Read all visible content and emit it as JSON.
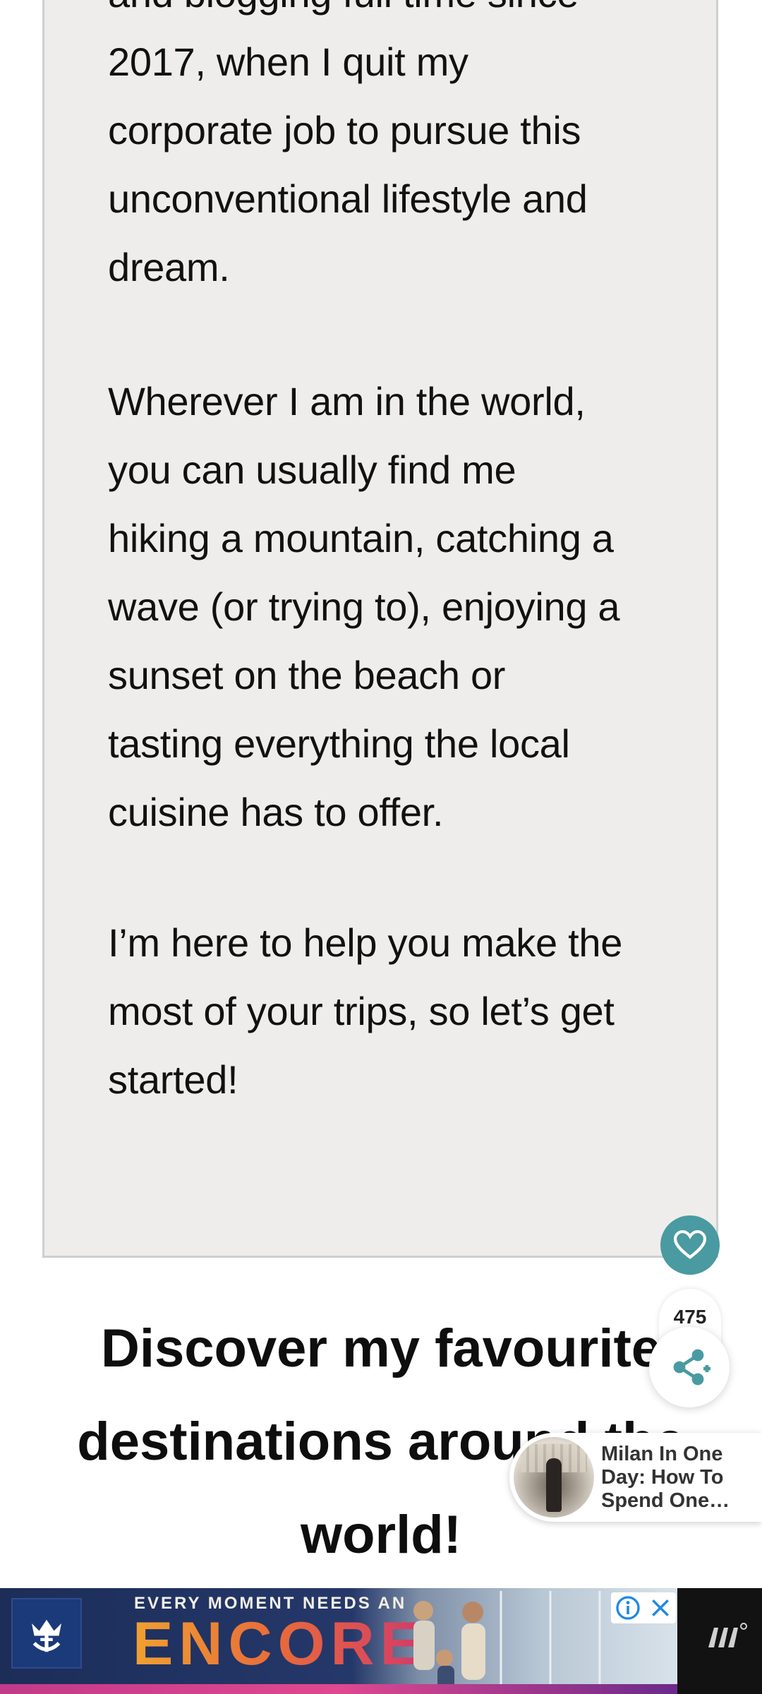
{
  "about": {
    "p1_lines": [
      "and blogging full time since",
      "2017, when I quit my",
      "corporate job to pursue this",
      "unconventional lifestyle and",
      "dream."
    ],
    "p2_lines": [
      "Wherever I am in the world,",
      "you can usually find me",
      "hiking a mountain, catching a",
      "wave (or trying to), enjoying a",
      "sunset on the beach or",
      "tasting everything the local",
      "cuisine has to offer."
    ],
    "p3_lines": [
      "I’m here to help you make the",
      "most of your trips, so let’s get",
      "started!"
    ]
  },
  "heading": {
    "lines": [
      "Discover my favourite",
      "destinations around the",
      "world!"
    ]
  },
  "share": {
    "count": "475",
    "heart_icon": "heart-icon",
    "share_icon": "share-icon",
    "accent_color": "#4a9aa2"
  },
  "recommendation": {
    "title": "Milan In One Day: How To Spend One…"
  },
  "ad": {
    "tagline": "EVERY MOMENT NEEDS AN",
    "headline": "ENCORE",
    "info_icon": "info-icon",
    "close_icon": "close-icon"
  }
}
